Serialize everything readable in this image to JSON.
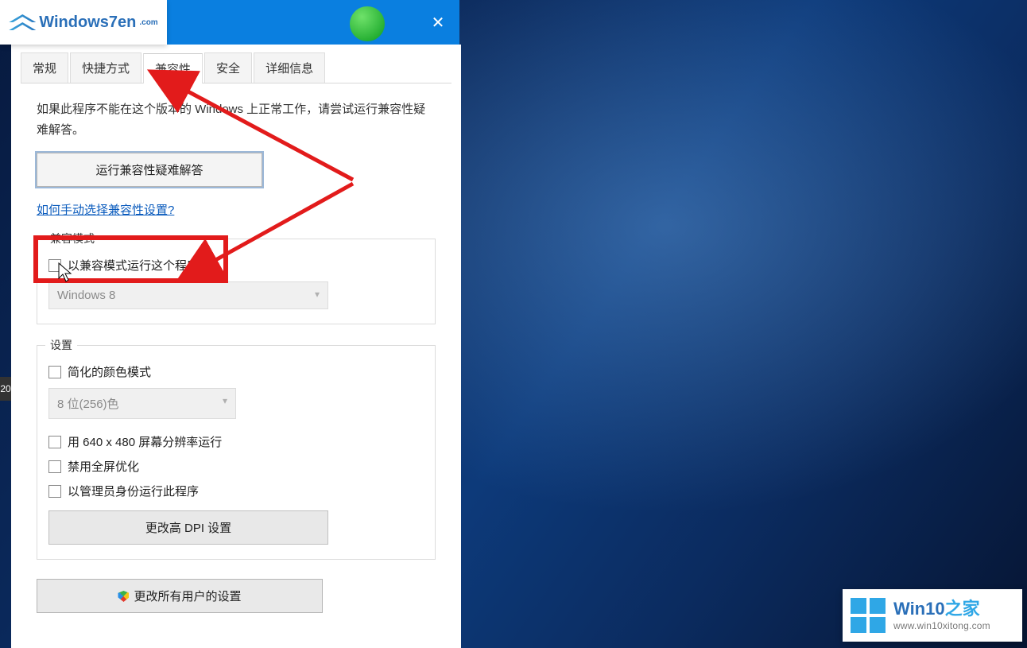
{
  "watermark_tl": {
    "text": "Windows7en",
    "com": ".com"
  },
  "watermark_br": {
    "title_main": "Win10",
    "title_cn": "之家",
    "url": "www.win10xitong.com"
  },
  "titlebar": {
    "close": "✕"
  },
  "tabs": {
    "general": "常规",
    "shortcut": "快捷方式",
    "compatibility": "兼容性",
    "security": "安全",
    "details": "详细信息"
  },
  "body": {
    "desc": "如果此程序不能在这个版本的 Windows 上正常工作，请尝试运行兼容性疑难解答。",
    "troubleshoot_btn": "运行兼容性疑难解答",
    "manual_link": "如何手动选择兼容性设置?"
  },
  "compat_mode": {
    "legend": "兼容模式",
    "checkbox": "以兼容模式运行这个程序:",
    "select_value": "Windows 8"
  },
  "settings": {
    "legend": "设置",
    "reduced_color": "简化的颜色模式",
    "color_select": "8 位(256)色",
    "low_res": "用 640 x 480 屏幕分辨率运行",
    "disable_fullscreen": "禁用全屏优化",
    "run_admin": "以管理员身份运行此程序",
    "dpi_btn": "更改高 DPI 设置"
  },
  "all_users_btn": "更改所有用户的设置",
  "left_edge": "20"
}
